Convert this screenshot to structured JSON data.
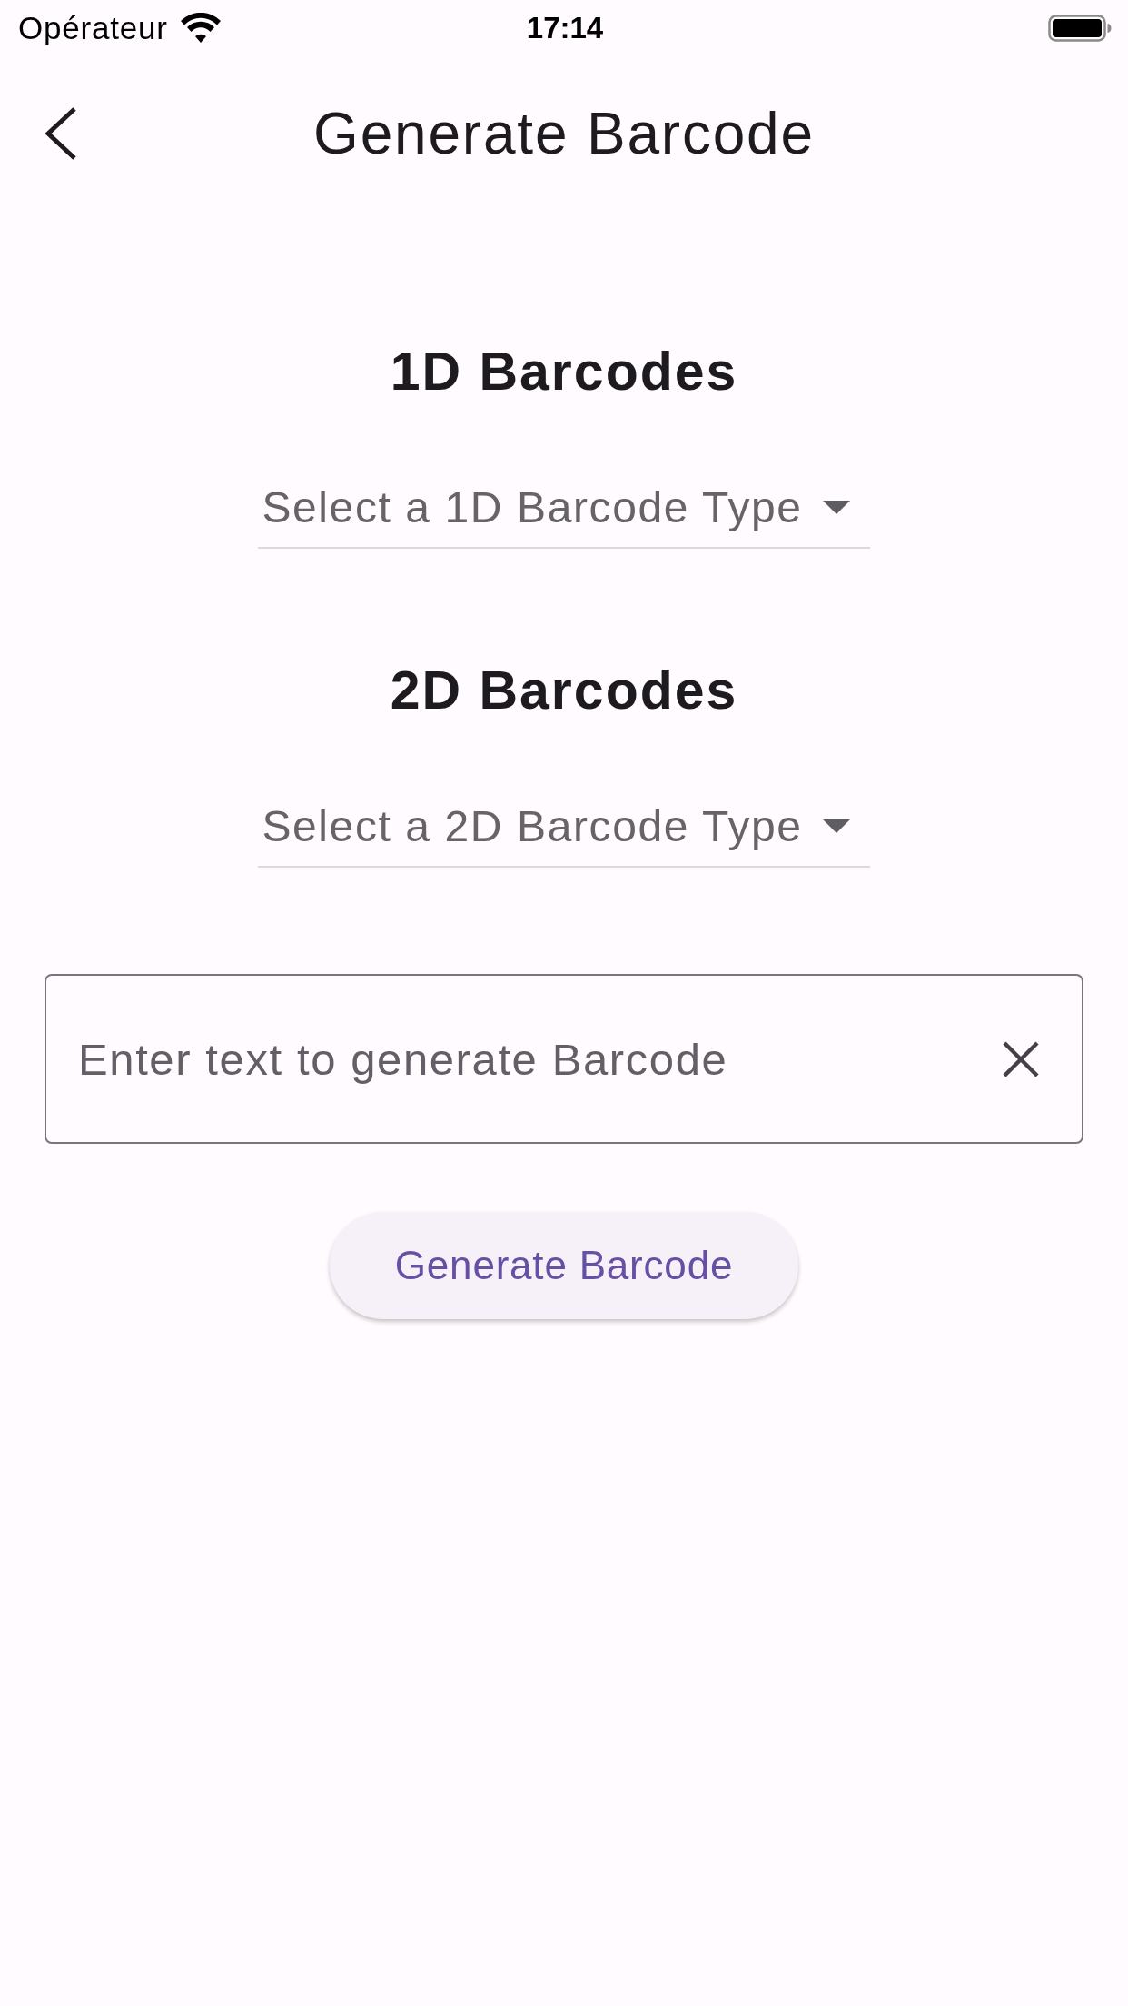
{
  "status_bar": {
    "carrier": "Opérateur",
    "time": "17:14"
  },
  "app_bar": {
    "title": "Generate Barcode"
  },
  "sections": [
    {
      "heading": "1D Barcodes",
      "dropdown": {
        "placeholder": "Select a 1D Barcode Type"
      }
    },
    {
      "heading": "2D Barcodes",
      "dropdown": {
        "placeholder": "Select a 2D Barcode Type"
      }
    }
  ],
  "text_field": {
    "placeholder": "Enter text to generate Barcode"
  },
  "button": {
    "label": "Generate Barcode"
  }
}
